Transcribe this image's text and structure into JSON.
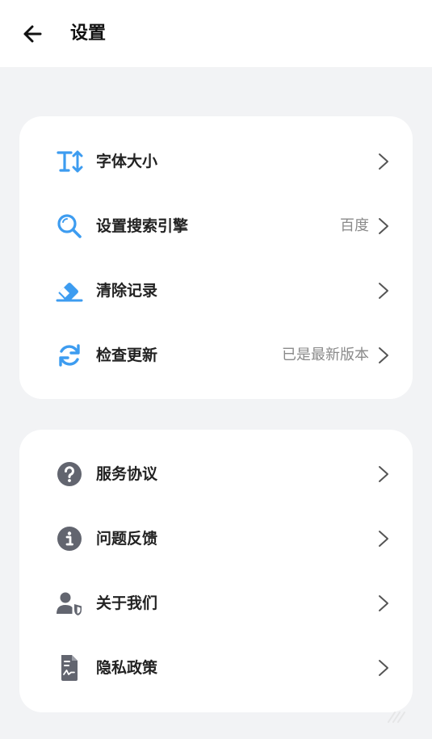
{
  "header": {
    "title": "设置",
    "back_icon": "arrow-left-icon"
  },
  "colors": {
    "accent": "#3d9cf0",
    "icon_gray": "#62656f",
    "background": "#f2f3f5"
  },
  "group1": {
    "items": [
      {
        "label": "字体大小",
        "value": "",
        "icon": "font-size-icon"
      },
      {
        "label": "设置搜索引擎",
        "value": "百度",
        "icon": "search-icon"
      },
      {
        "label": "清除记录",
        "value": "",
        "icon": "eraser-icon"
      },
      {
        "label": "检查更新",
        "value": "已是最新版本",
        "icon": "refresh-icon"
      }
    ]
  },
  "group2": {
    "items": [
      {
        "label": "服务协议",
        "value": "",
        "icon": "question-icon"
      },
      {
        "label": "问题反馈",
        "value": "",
        "icon": "info-icon"
      },
      {
        "label": "关于我们",
        "value": "",
        "icon": "user-shield-icon"
      },
      {
        "label": "隐私政策",
        "value": "",
        "icon": "document-icon"
      }
    ]
  }
}
